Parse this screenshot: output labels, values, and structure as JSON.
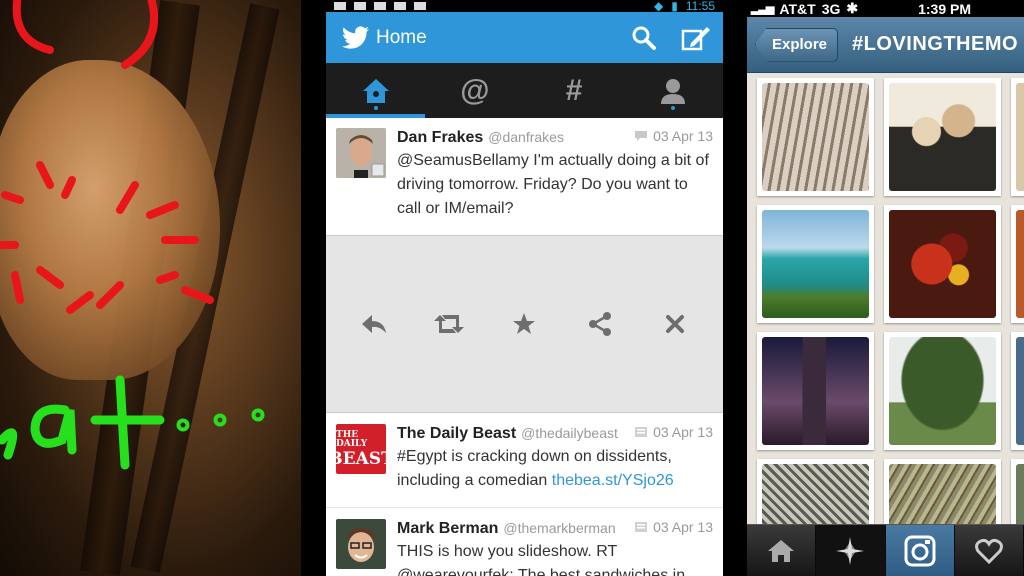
{
  "twitter": {
    "status_time": "11:55",
    "header_title": "Home",
    "tabs": [
      {
        "icon": "home-icon"
      },
      {
        "icon": "at-icon",
        "glyph": "@"
      },
      {
        "icon": "hashtag-icon",
        "glyph": "#"
      },
      {
        "icon": "profile-icon"
      }
    ],
    "tweets": [
      {
        "name": "Dan Frakes",
        "handle": "@danfrakes",
        "date": "03 Apr 13",
        "text": "@SeamusBellamy I'm actually doing a bit of driving tomorrow. Friday? Do you want to call or IM/email?",
        "link": ""
      },
      {
        "name": "The Daily Beast",
        "handle": "@thedailybeast",
        "date": "03 Apr 13",
        "text": "#Egypt is cracking down on dissidents, including a comedian ",
        "link": "thebea.st/YSjo26",
        "avatar_line1": "THE DAILY",
        "avatar_line2": "BEAST"
      },
      {
        "name": "Mark Berman",
        "handle": "@themarkberman",
        "date": "03 Apr 13",
        "text": "THIS is how you slideshow. RT @wearevourfek: The best sandwiches in",
        "link": ""
      }
    ],
    "accent": "#2f96d9"
  },
  "instagram": {
    "carrier": "AT&T",
    "network": "3G",
    "time": "1:39 PM",
    "back_label": "Explore",
    "title": "#LOVINGTHEMO",
    "accent": "#3e6788"
  }
}
